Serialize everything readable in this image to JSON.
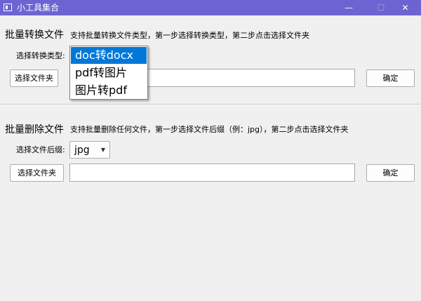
{
  "window": {
    "title": "小工具集合"
  },
  "window_controls": {
    "minimize": "—",
    "maximize": "☐",
    "close": "✕"
  },
  "convert": {
    "heading": "批量转换文件",
    "description": "支持批量转换文件类型，第一步选择转换类型，第二步点击选择文件夹",
    "type_label": "选择转换类型:",
    "type_options": [
      "doc转docx",
      "pdf转图片",
      "图片转pdf"
    ],
    "type_selected": "doc转docx",
    "folder_button": "选择文件夹",
    "path_value": "",
    "confirm_button": "确定"
  },
  "delete": {
    "heading": "批量删除文件",
    "description": "支持批量删除任何文件，第一步选择文件后缀（例：jpg），第二步点击选择文件夹",
    "suffix_label": "选择文件后缀:",
    "suffix_selected": "jpg",
    "folder_button": "选择文件夹",
    "path_value": "",
    "confirm_button": "确定"
  },
  "colors": {
    "titlebar": "#6b64d1",
    "selection": "#0078d7",
    "background": "#f0f0f0"
  },
  "icons": {
    "app": "app-window-icon",
    "dropdown": "chevron-down-icon"
  }
}
